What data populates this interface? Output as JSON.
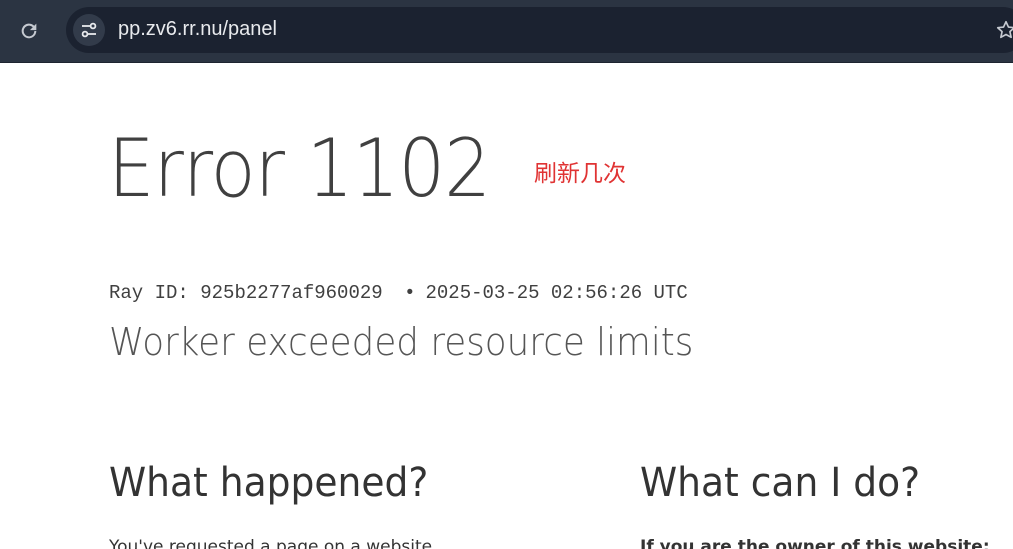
{
  "browser": {
    "url": "pp.zv6.rr.nu/panel",
    "reload_icon": "reload-icon",
    "site_info_icon": "tune-icon",
    "bookmark_icon": "star-icon"
  },
  "error": {
    "title": "Error 1102",
    "annotation": "刷新几次",
    "ray_id_label": "Ray ID:",
    "ray_id": "925b2277af960029",
    "separator": "•",
    "timestamp": "2025-03-25 02:56:26 UTC",
    "subtitle": "Worker exceeded resource limits"
  },
  "sections": {
    "what_happened": {
      "heading": "What happened?",
      "text": "You've requested a page on a website"
    },
    "what_can_i_do": {
      "heading": "What can I do?",
      "text": "If you are the owner of this website:"
    }
  },
  "colors": {
    "toolbar": "#2b3442",
    "omnibox": "#1b2230",
    "annotation": "#e03333",
    "text": "#404040"
  }
}
